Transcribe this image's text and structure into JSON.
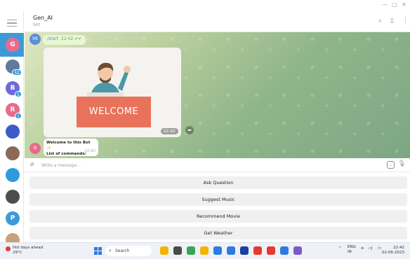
{
  "window": {
    "min": "—",
    "max": "▢",
    "close": "✕"
  },
  "rail": {
    "items": [
      {
        "initial": "G",
        "color": "#e86b8c",
        "active": true
      },
      {
        "initial": "",
        "color": "#5f7a9a",
        "badge": "52"
      },
      {
        "initial": "B",
        "color": "#6d6bd6",
        "badge": "1"
      },
      {
        "initial": "R",
        "color": "#e86b8c",
        "badge": "1"
      },
      {
        "initial": "",
        "color": "#3a5bc8"
      },
      {
        "initial": "",
        "color": "#8b6a55"
      },
      {
        "initial": "",
        "color": "#2f9bdc"
      },
      {
        "initial": "",
        "color": "#4d4d4d"
      },
      {
        "initial": "P",
        "color": "#3e9ad7"
      },
      {
        "initial": "",
        "color": "#c8a07a"
      }
    ]
  },
  "header": {
    "title": "Gen_AI",
    "subtitle": "bot"
  },
  "messages": {
    "outgoing": {
      "sender_initials": "VK",
      "text": "/start",
      "time": "22:42 ✔✔"
    },
    "image": {
      "caption": "WELCOME",
      "time": "22:42"
    },
    "incoming": {
      "sender_initials": "B",
      "line1": "Welcome to this Bot ✨",
      "line2": "List of commands:",
      "time": "22:42"
    }
  },
  "composer": {
    "placeholder": "Write a message..."
  },
  "keyboard": [
    {
      "label": "Ask Question"
    },
    {
      "label": "Suggest Music"
    },
    {
      "label": "Recommend Movie"
    },
    {
      "label": "Get Weather"
    }
  ],
  "taskbar": {
    "weather_line1": "Hot days ahead",
    "weather_line2": "29°C",
    "search_label": "Search",
    "lang_line1": "ENG",
    "lang_line2": "IN",
    "time": "22:42",
    "date": "02-06-2023",
    "app_icon_colors": [
      "#f4b400",
      "#4a4a4a",
      "#34a853",
      "#f4b400",
      "#2d7be0",
      "#2d7be0",
      "#1a3fa0",
      "#e53935",
      "#e53935",
      "#2d7be0",
      "#7a5cc9"
    ]
  }
}
